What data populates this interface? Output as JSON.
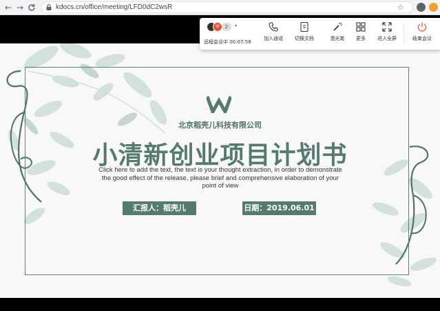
{
  "browser": {
    "url": "kdocs.cn/office/meeting/LFD0dC2wsR",
    "back_glyph": "←",
    "forward_glyph": "→",
    "reload_glyph": "C",
    "star_glyph": "☆"
  },
  "meeting_toolbar": {
    "participant_count": "2",
    "participant_initial": "W",
    "caret_glyph": "▾",
    "session_label": "远程会议中 00:07:58",
    "items": [
      {
        "label": "加入通话",
        "icon": "phone-icon"
      },
      {
        "label": "切换文档",
        "icon": "switch-doc-icon"
      },
      {
        "label": "激光笔",
        "icon": "laser-pointer-icon"
      },
      {
        "label": "更多",
        "icon": "more-grid-icon"
      },
      {
        "label": "进入全屏",
        "icon": "fullscreen-icon"
      },
      {
        "label": "结束会议",
        "icon": "power-icon"
      }
    ],
    "accent_color": "#e8542e"
  },
  "slide": {
    "company": "北京稻壳儿科技有限公司",
    "title": "小清新创业项目计划书",
    "description": "Click here to add the text, the text is your thought extraction, in order to demonstrate the good effect of the release, please brief and comprehensive elaboration of your point of view",
    "reporter": "汇报人：稻壳儿",
    "date": "日期：2019.06.01",
    "theme_color": "#557a6e"
  }
}
